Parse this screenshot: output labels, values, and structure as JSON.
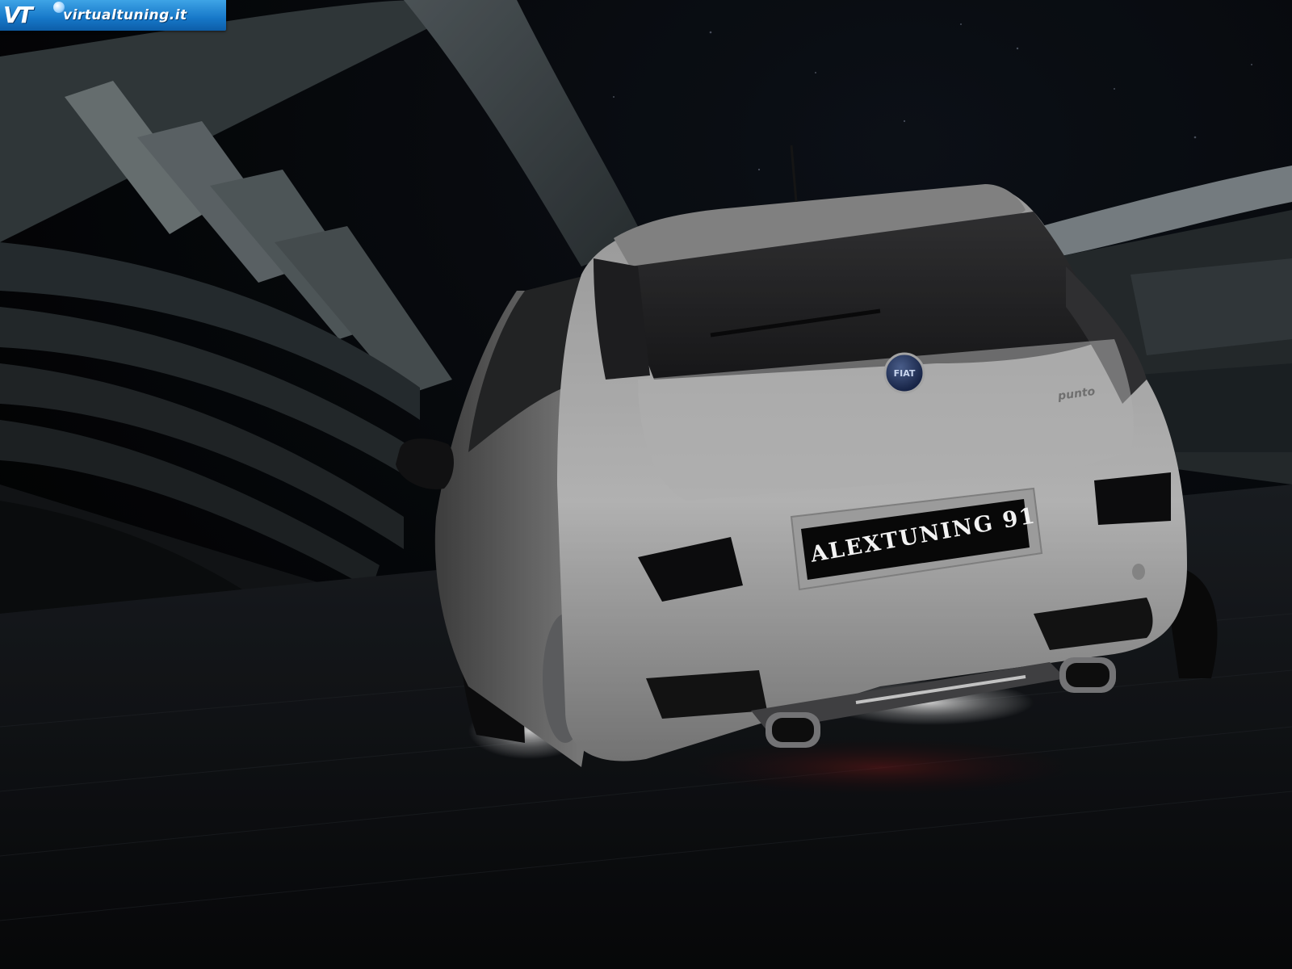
{
  "watermark": {
    "mark": "VT",
    "text": "virtualtuning.it",
    "colors": {
      "top": "#3ea4e6",
      "bottom": "#0d5ea8"
    }
  },
  "car": {
    "make_badge": "FIAT",
    "model_badge": "punto",
    "plate": "ALEXTUNING 91",
    "body_color": "#cfcfcf"
  },
  "scene": {
    "setting": "night, modern arched architecture, cobblestone ground",
    "sky_color": "#06080d",
    "ground_color": "#121418"
  }
}
